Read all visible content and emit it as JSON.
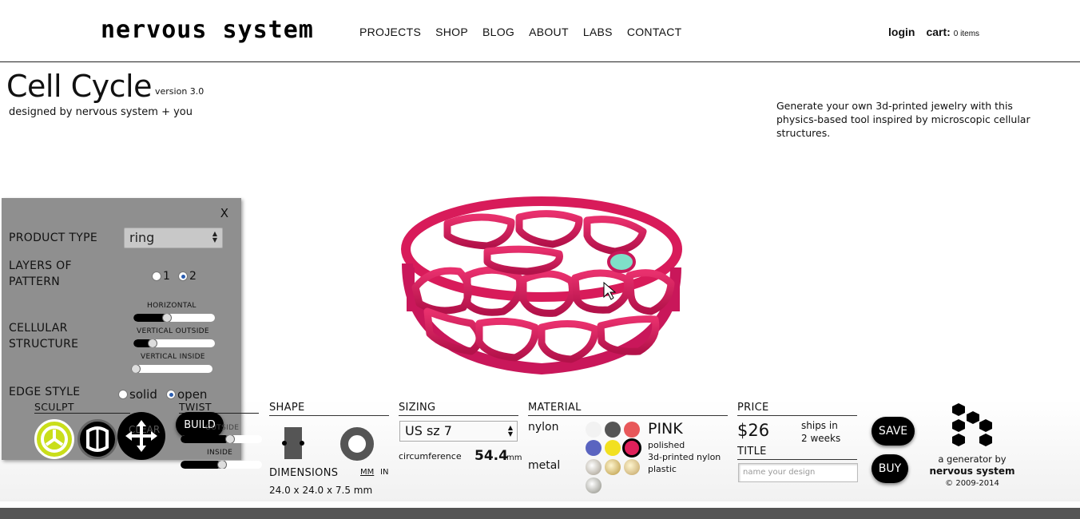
{
  "header": {
    "logo": "nervous system",
    "nav": [
      "PROJECTS",
      "SHOP",
      "BLOG",
      "ABOUT",
      "LABS",
      "CONTACT"
    ],
    "login": "login",
    "cart_label": "cart:",
    "cart_count": "0 items"
  },
  "page": {
    "title": "Cell Cycle",
    "version": "version 3.0",
    "designed_by": "designed by nervous system + you",
    "intro": "Generate your own 3d-printed jewelry with this physics-based tool inspired by microscopic cellular structures."
  },
  "panel": {
    "close": "X",
    "product_type_label": "PRODUCT TYPE",
    "product_type_value": "ring",
    "layers_label_1": "LAYERS OF",
    "layers_label_2": "PATTERN",
    "layers_options": [
      "1",
      "2"
    ],
    "layers_selected": "2",
    "cellular_label_1": "CELLULAR",
    "cellular_label_2": "STRUCTURE",
    "sliders": [
      {
        "label": "HORIZONTAL",
        "value": 0.38
      },
      {
        "label": "VERTICAL OUTSIDE",
        "value": 0.2
      },
      {
        "label": "VERTICAL INSIDE",
        "value": 0.0
      }
    ],
    "edge_label": "EDGE STYLE",
    "edge_options": [
      "solid",
      "open"
    ],
    "edge_selected": "open",
    "sculpt_label": "SCULPT",
    "twist_label": "TWIST",
    "clear_label": "CLEAR",
    "build_label": "BUILD",
    "twist_sliders": [
      {
        "label": "OUTSIDE",
        "value": 0.6
      },
      {
        "label": "INSIDE",
        "value": 0.5
      }
    ]
  },
  "shape": {
    "head": "SHAPE",
    "dimensions_label": "DIMENSIONS",
    "unit_mm": "MM",
    "unit_in": "IN",
    "dimensions_value": "24.0 x 24.0 x 7.5 mm"
  },
  "sizing": {
    "head": "SIZING",
    "size_value": "US sz 7",
    "circumference_label": "circumference",
    "circumference_value": "54.4",
    "circumference_unit": "mm"
  },
  "material": {
    "head": "MATERIAL",
    "nylon_label": "nylon",
    "metal_label": "metal",
    "selected_name": "PINK",
    "desc_1": "polished",
    "desc_2": "3d-printed nylon",
    "desc_3": "plastic",
    "nylon_colors": [
      "#f2f2f2",
      "#555555",
      "#e8585a",
      "#5a64c0",
      "#f2e020",
      "#e0205a"
    ],
    "selected_color": "#e0205a",
    "ring_color": "#d81b5a"
  },
  "price": {
    "head": "PRICE",
    "amount": "$26",
    "ships_1": "ships in",
    "ships_2": "2 weeks",
    "title_head": "TITLE",
    "name_placeholder": "name your design",
    "save": "SAVE",
    "buy": "BUY"
  },
  "credit": {
    "line1": "a generator by",
    "line2": "nervous system",
    "line3": "© 2009-2014"
  }
}
